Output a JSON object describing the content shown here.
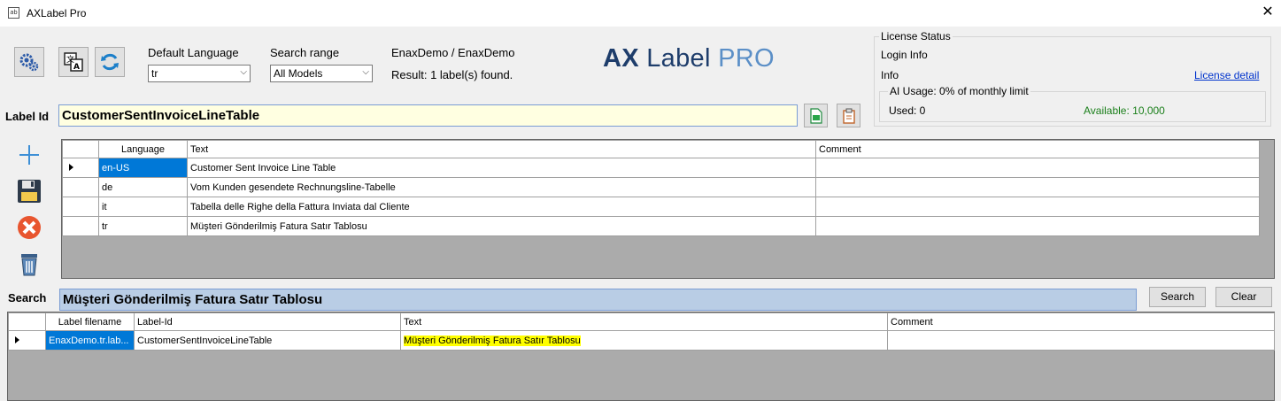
{
  "window": {
    "title": "AXLabel Pro",
    "app_icon_text": "ab"
  },
  "toolbar": {
    "default_language_label": "Default Language",
    "default_language_value": "tr",
    "search_range_label": "Search range",
    "search_range_value": "All Models",
    "model_text": "EnaxDemo / EnaxDemo",
    "result_text": "Result: 1 label(s) found."
  },
  "logo": {
    "ax": "AX",
    "label": "Label",
    "pro": "PRO"
  },
  "license": {
    "legend": "License Status",
    "login_info": "Login Info",
    "info": "Info",
    "detail_link": "License detail",
    "ai_legend": "AI Usage: 0% of monthly limit",
    "used": "Used: 0",
    "available": "Available: 10,000"
  },
  "label_id": {
    "label": "Label Id",
    "value": "CustomerSentInvoiceLineTable"
  },
  "label_grid": {
    "headers": [
      "Language",
      "Text",
      "Comment"
    ],
    "rows": [
      {
        "lang": "en-US",
        "text": "Customer Sent Invoice Line Table",
        "comment": ""
      },
      {
        "lang": "de",
        "text": "Vom Kunden gesendete Rechnungsline-Tabelle",
        "comment": ""
      },
      {
        "lang": "it",
        "text": "Tabella delle Righe della Fattura Inviata dal Cliente",
        "comment": ""
      },
      {
        "lang": "tr",
        "text": "Müşteri Gönderilmiş Fatura Satır Tablosu",
        "comment": ""
      }
    ]
  },
  "search": {
    "label": "Search",
    "value": "Müşteri Gönderilmiş Fatura Satır Tablosu",
    "search_button": "Search",
    "clear_button": "Clear"
  },
  "result_grid": {
    "headers": [
      "Label filename",
      "Label-Id",
      "Text",
      "Comment"
    ],
    "rows": [
      {
        "file": "EnaxDemo.tr.lab...",
        "id": "CustomerSentInvoiceLineTable",
        "text": "Müşteri Gönderilmiş Fatura Satır Tablosu",
        "comment": ""
      }
    ]
  },
  "colors": {
    "accent": "#0078d7",
    "highlight": "#ffff00",
    "search_bg": "#b9cde5",
    "label_id_bg": "#ffffe1"
  }
}
